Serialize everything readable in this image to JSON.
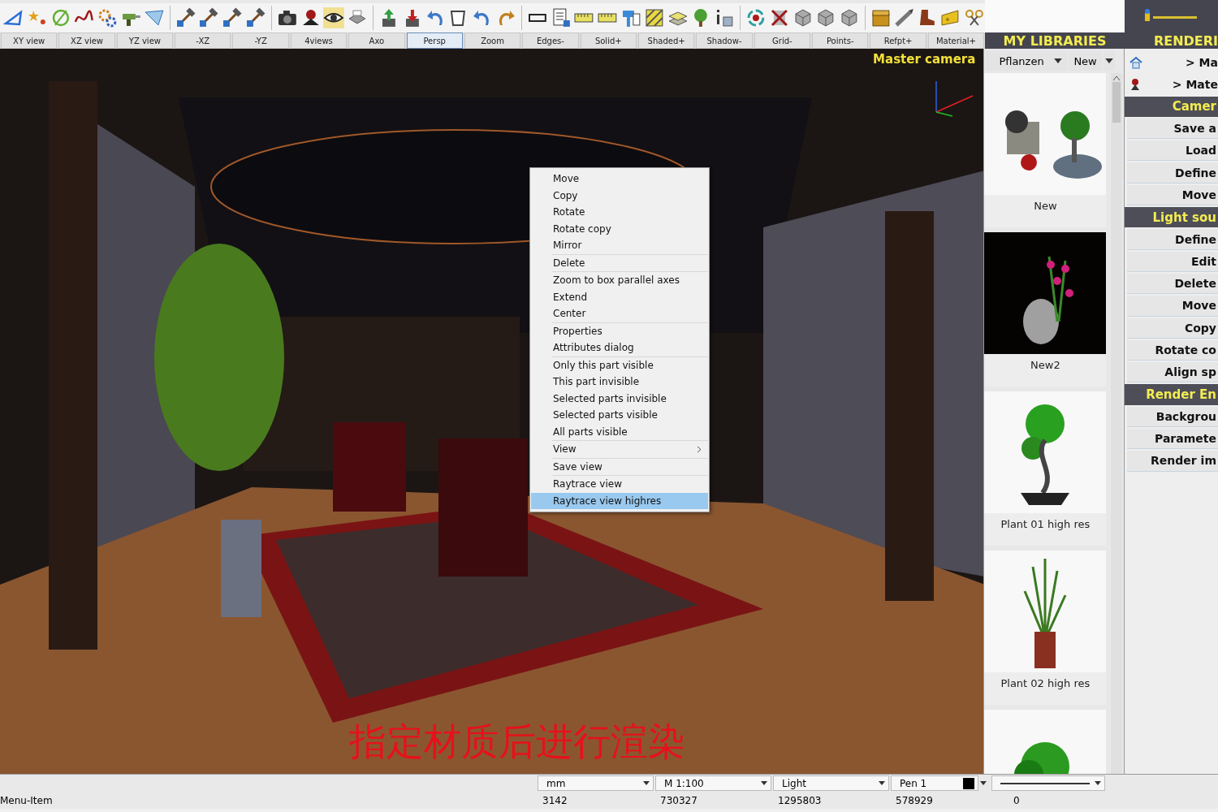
{
  "toolbar": {
    "view_buttons": [
      {
        "label": "XY view",
        "selected": false
      },
      {
        "label": "XZ view",
        "selected": false
      },
      {
        "label": "YZ view",
        "selected": false
      },
      {
        "label": "-XZ",
        "selected": false
      },
      {
        "label": "-YZ",
        "selected": false
      },
      {
        "label": "4views",
        "selected": false
      },
      {
        "label": "Axo",
        "selected": false
      },
      {
        "label": "Persp",
        "selected": true
      },
      {
        "label": "Zoom",
        "selected": false
      },
      {
        "label": "Edges-",
        "selected": false
      },
      {
        "label": "Solid+",
        "selected": false
      },
      {
        "label": "Shaded+",
        "selected": false
      },
      {
        "label": "Shadow-",
        "selected": false
      },
      {
        "label": "Grid-",
        "selected": false
      },
      {
        "label": "Points-",
        "selected": false
      },
      {
        "label": "Refpt+",
        "selected": false
      },
      {
        "label": "Material+",
        "selected": false
      }
    ]
  },
  "viewport": {
    "camera_label": "Master camera",
    "caption": "指定材质后进行渲染",
    "context_menu": {
      "groups": [
        [
          {
            "label": "Move",
            "submenu": false,
            "selected": false
          },
          {
            "label": "Copy",
            "submenu": false,
            "selected": false
          },
          {
            "label": "Rotate",
            "submenu": false,
            "selected": false
          },
          {
            "label": "Rotate copy",
            "submenu": false,
            "selected": false
          },
          {
            "label": "Mirror",
            "submenu": false,
            "selected": false
          }
        ],
        [
          {
            "label": "Delete",
            "submenu": false,
            "selected": false
          }
        ],
        [
          {
            "label": "Zoom to box parallel axes",
            "submenu": false,
            "selected": false
          },
          {
            "label": "Extend",
            "submenu": false,
            "selected": false
          },
          {
            "label": "Center",
            "submenu": false,
            "selected": false
          }
        ],
        [
          {
            "label": "Properties",
            "submenu": false,
            "selected": false
          },
          {
            "label": "Attributes dialog",
            "submenu": false,
            "selected": false
          }
        ],
        [
          {
            "label": "Only this part visible",
            "submenu": false,
            "selected": false
          },
          {
            "label": "This part invisible",
            "submenu": false,
            "selected": false
          },
          {
            "label": "Selected parts invisible",
            "submenu": false,
            "selected": false
          },
          {
            "label": "Selected parts visible",
            "submenu": false,
            "selected": false
          },
          {
            "label": "All parts visible",
            "submenu": false,
            "selected": false
          }
        ],
        [
          {
            "label": "View",
            "submenu": true,
            "selected": false
          }
        ],
        [
          {
            "label": "Save view",
            "submenu": false,
            "selected": false
          }
        ],
        [
          {
            "label": "Raytrace view",
            "submenu": false,
            "selected": false
          },
          {
            "label": "Raytrace view highres",
            "submenu": false,
            "selected": true
          }
        ]
      ]
    }
  },
  "library": {
    "title": "MY LIBRARIES",
    "category": "Pflanzen",
    "new_button": "New",
    "items": [
      {
        "kind": "pot",
        "label": "New"
      },
      {
        "kind": "orchid",
        "label": "New2"
      },
      {
        "kind": "bonsai",
        "label": "Plant 01 high res"
      },
      {
        "kind": "grass",
        "label": "Plant 02 high res"
      },
      {
        "kind": "shrub"
      }
    ]
  },
  "render_panel": {
    "title": "RENDERI",
    "rows": [
      {
        "kind": "home",
        "label": "> Ma"
      },
      {
        "kind": "material",
        "label": "> Mate"
      },
      {
        "kind": "header",
        "label": "Camer"
      },
      {
        "kind": "button",
        "label": "Save a"
      },
      {
        "kind": "button",
        "label": "Load"
      },
      {
        "kind": "button",
        "label": "Define"
      },
      {
        "kind": "button",
        "label": "Move"
      },
      {
        "kind": "header",
        "label": "Light sou"
      },
      {
        "kind": "button",
        "label": "Define"
      },
      {
        "kind": "button",
        "label": "Edit"
      },
      {
        "kind": "button",
        "label": "Delete"
      },
      {
        "kind": "button",
        "label": "Move"
      },
      {
        "kind": "button",
        "label": "Copy"
      },
      {
        "kind": "button",
        "label": "Rotate co"
      },
      {
        "kind": "button",
        "label": "Align sp"
      },
      {
        "kind": "header",
        "label": "Render En"
      },
      {
        "kind": "button",
        "label": "Backgrou"
      },
      {
        "kind": "button",
        "label": "Paramete"
      },
      {
        "kind": "button",
        "label": "Render im"
      }
    ]
  },
  "status_bar": {
    "selects": [
      "mm",
      "M 1:100",
      "Light",
      "Pen 1"
    ],
    "message": "Menu-Item",
    "readouts": [
      "3142",
      "730327",
      "1295803",
      "578929",
      "0"
    ]
  }
}
